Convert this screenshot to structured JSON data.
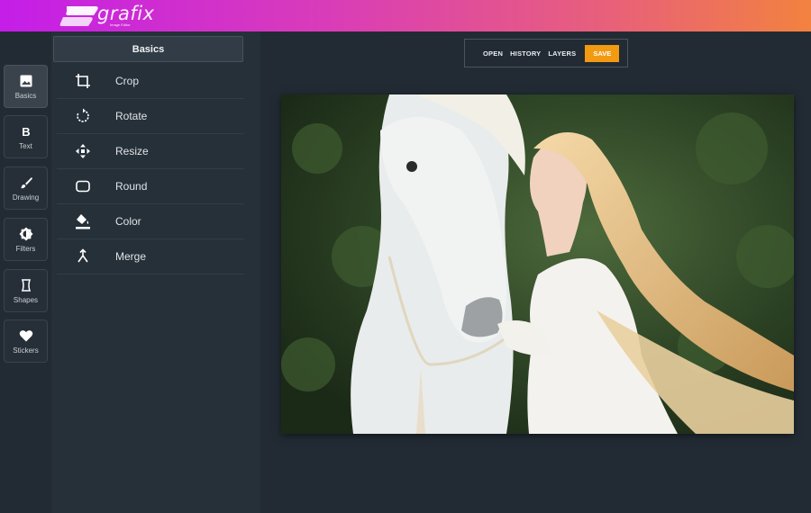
{
  "app": {
    "name": "grafix",
    "tagline": "Image Editor"
  },
  "rail": {
    "items": [
      {
        "label": "Basics",
        "icon": "image-icon",
        "active": true
      },
      {
        "label": "Text",
        "icon": "bold-b-icon",
        "active": false
      },
      {
        "label": "Drawing",
        "icon": "brush-icon",
        "active": false
      },
      {
        "label": "Filters",
        "icon": "contrast-icon",
        "active": false
      },
      {
        "label": "Shapes",
        "icon": "shape-icon",
        "active": false
      },
      {
        "label": "Stickers",
        "icon": "heart-icon",
        "active": false
      }
    ]
  },
  "panel": {
    "title": "Basics",
    "tools": [
      {
        "label": "Crop",
        "icon": "crop-icon"
      },
      {
        "label": "Rotate",
        "icon": "rotate-icon"
      },
      {
        "label": "Resize",
        "icon": "resize-icon"
      },
      {
        "label": "Round",
        "icon": "round-corners-icon"
      },
      {
        "label": "Color",
        "icon": "paint-bucket-icon"
      },
      {
        "label": "Merge",
        "icon": "merge-icon"
      }
    ]
  },
  "toolbar": {
    "open": "OPEN",
    "history": "HISTORY",
    "layers": "LAYERS",
    "save": "SAVE"
  },
  "colors": {
    "accent": "#f29a12",
    "gradient_start": "#c41ee8",
    "gradient_end": "#f2823f"
  }
}
